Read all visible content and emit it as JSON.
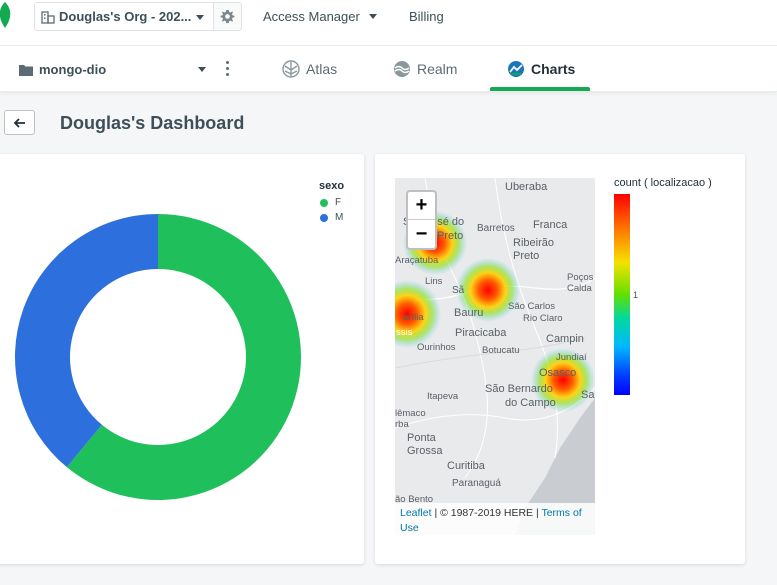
{
  "header": {
    "org_name": "Douglas's Org - 202...",
    "access_manager": "Access Manager",
    "billing": "Billing"
  },
  "nav": {
    "project": "mongo-dio",
    "tabs": [
      {
        "label": "Atlas",
        "icon": "atlas-icon"
      },
      {
        "label": "Realm",
        "icon": "realm-icon"
      },
      {
        "label": "Charts",
        "icon": "charts-icon",
        "active": true
      }
    ]
  },
  "dashboard": {
    "title": "Douglas's Dashboard"
  },
  "donut_chart": {
    "legend_title": "sexo",
    "legend": [
      {
        "label": "F",
        "color": "#1fc05b"
      },
      {
        "label": "M",
        "color": "#2d6fdd"
      }
    ]
  },
  "chart_data": [
    {
      "type": "pie",
      "variant": "donut",
      "legend_title": "sexo",
      "categories": [
        "F",
        "M"
      ],
      "values": [
        61,
        39
      ],
      "colors": [
        "#1fc05b",
        "#2d6fdd"
      ],
      "legend_placement": "top-right"
    },
    {
      "type": "heatmap",
      "variant": "geo-heatmap",
      "legend_title": "count ( localizacao )",
      "colorbar_ticks": [
        "1"
      ],
      "legend_placement": "right"
    }
  ],
  "heatmap": {
    "legend_title": "count ( localizacao )",
    "tick_label": "1",
    "zoom_in": "+",
    "zoom_out": "−",
    "attribution_link": "Leaflet",
    "attribution_text": " | © 1987-2019 HERE | ",
    "attribution_terms": "Terms of Use",
    "map_labels": {
      "uberaba": "Uberaba",
      "sao_jose": "São José do",
      "preto_a": "Preto",
      "barretos": "Barretos",
      "franca": "Franca",
      "ribeirao": "Ribeirão",
      "preto_b": "Preto",
      "aracatuba": "Araçatuba",
      "lins": "Lins",
      "pocos": "Poços",
      "caldas": "Calda",
      "sao_carlos": "São Carlos",
      "bauru": "Bauru",
      "rio_claro": "Rio Claro",
      "marilia": "arília",
      "piracicaba": "Piracicaba",
      "campinas": "Campin",
      "ourinhos": "Ourinhos",
      "botucatu": "Botucatu",
      "jundiai": "Jundiaí",
      "osasco": "Osasco",
      "sao_bernardo": "São Bernardo",
      "do_campo": "do Campo",
      "itapeva": "Itapeva",
      "telemaco": "lêmaco",
      "borba": "rba",
      "ponta": "Ponta",
      "grossa": "Grossa",
      "curitiba": "Curitiba",
      "paranagua": "Paranaguá",
      "blumenau": "ão Bento",
      "assis": "ssis",
      "sao_p": "Sã",
      "sa": "Sa"
    }
  }
}
